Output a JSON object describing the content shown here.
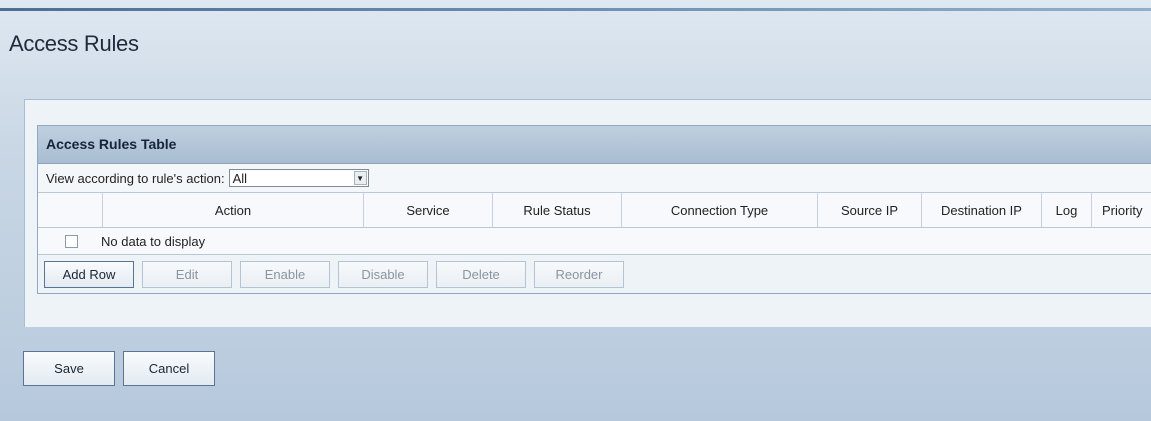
{
  "page": {
    "title": "Access Rules"
  },
  "table": {
    "title": "Access Rules Table",
    "filter": {
      "label": "View according to rule's action:",
      "value": "All"
    },
    "columns": [
      "Action",
      "Service",
      "Rule Status",
      "Connection Type",
      "Source IP",
      "Destination IP",
      "Log",
      "Priority"
    ],
    "empty_message": "No data to display",
    "buttons": {
      "add_row": "Add Row",
      "edit": "Edit",
      "enable": "Enable",
      "disable": "Disable",
      "delete": "Delete",
      "reorder": "Reorder"
    }
  },
  "form": {
    "save": "Save",
    "cancel": "Cancel"
  }
}
